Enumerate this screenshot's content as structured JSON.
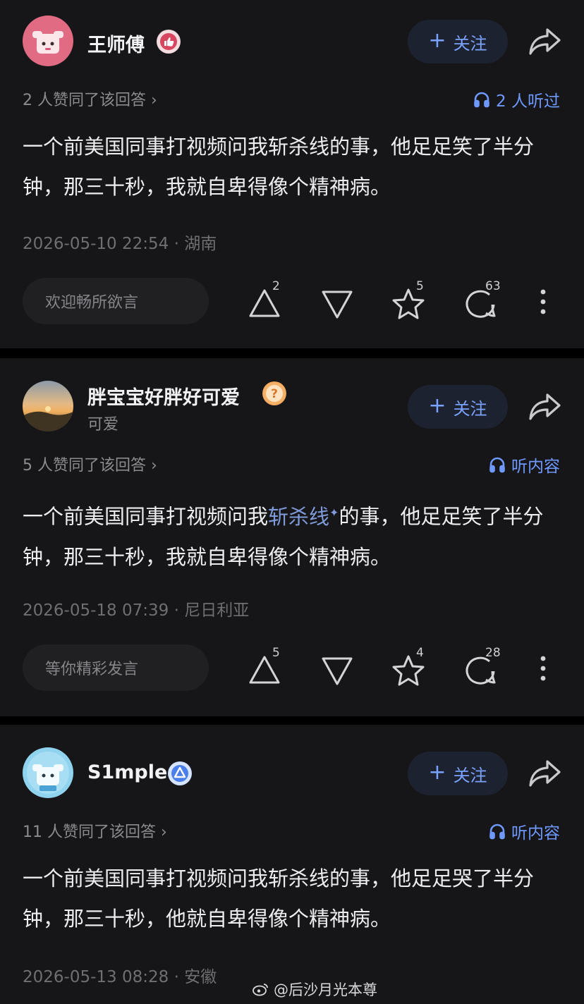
{
  "posts": [
    {
      "username": "王师傅",
      "badge_icon": "thumb-up-badge-icon",
      "follow_label": "关注",
      "agree_text": "2 人赞同了该回答 ›",
      "listen_text": "2 人听过",
      "answer_text": "一个前美国同事打视频问我斩杀线的事，他足足笑了半分钟，那三十秒，我就自卑得像个精神病。",
      "timestamp": "2026-05-10 22:54 · 湖南",
      "comment_placeholder": "欢迎畅所欲言",
      "upvotes": "2",
      "favorites": "5",
      "comments": "63"
    },
    {
      "username": "胖宝宝好胖好可爱",
      "badge_icon": "question-badge-icon",
      "subtitle": "可爱",
      "follow_label": "关注",
      "agree_text": "5 人赞同了该回答 ›",
      "listen_text": "听内容",
      "answer_prefix": "一个前美国同事打视频问我",
      "answer_highlight": "斩杀线",
      "answer_suffix": "的事，他足足笑了半分钟，那三十秒，我就自卑得像个精神病。",
      "timestamp": "2026-05-18 07:39 · 尼日利亚",
      "comment_placeholder": "等你精彩发言",
      "upvotes": "5",
      "favorites": "4",
      "comments": "28"
    },
    {
      "username": "S1mple",
      "badge_icon": "verified-triangle-badge-icon",
      "follow_label": "关注",
      "agree_text": "11 人赞同了该回答 ›",
      "listen_text": "听内容",
      "answer_text": "一个前美国同事打视频问我斩杀线的事，他足足哭了半分钟，那三十秒，他就自卑得像个精神病。",
      "timestamp": "2026-05-13 08:28 · 安徽"
    }
  ],
  "watermark": "@后沙月光本尊",
  "colors": {
    "background": "#000000",
    "card": "#161618",
    "accent": "#6f99ff",
    "follow_bg": "#1d2230",
    "secondary_text": "#8b8b90"
  }
}
